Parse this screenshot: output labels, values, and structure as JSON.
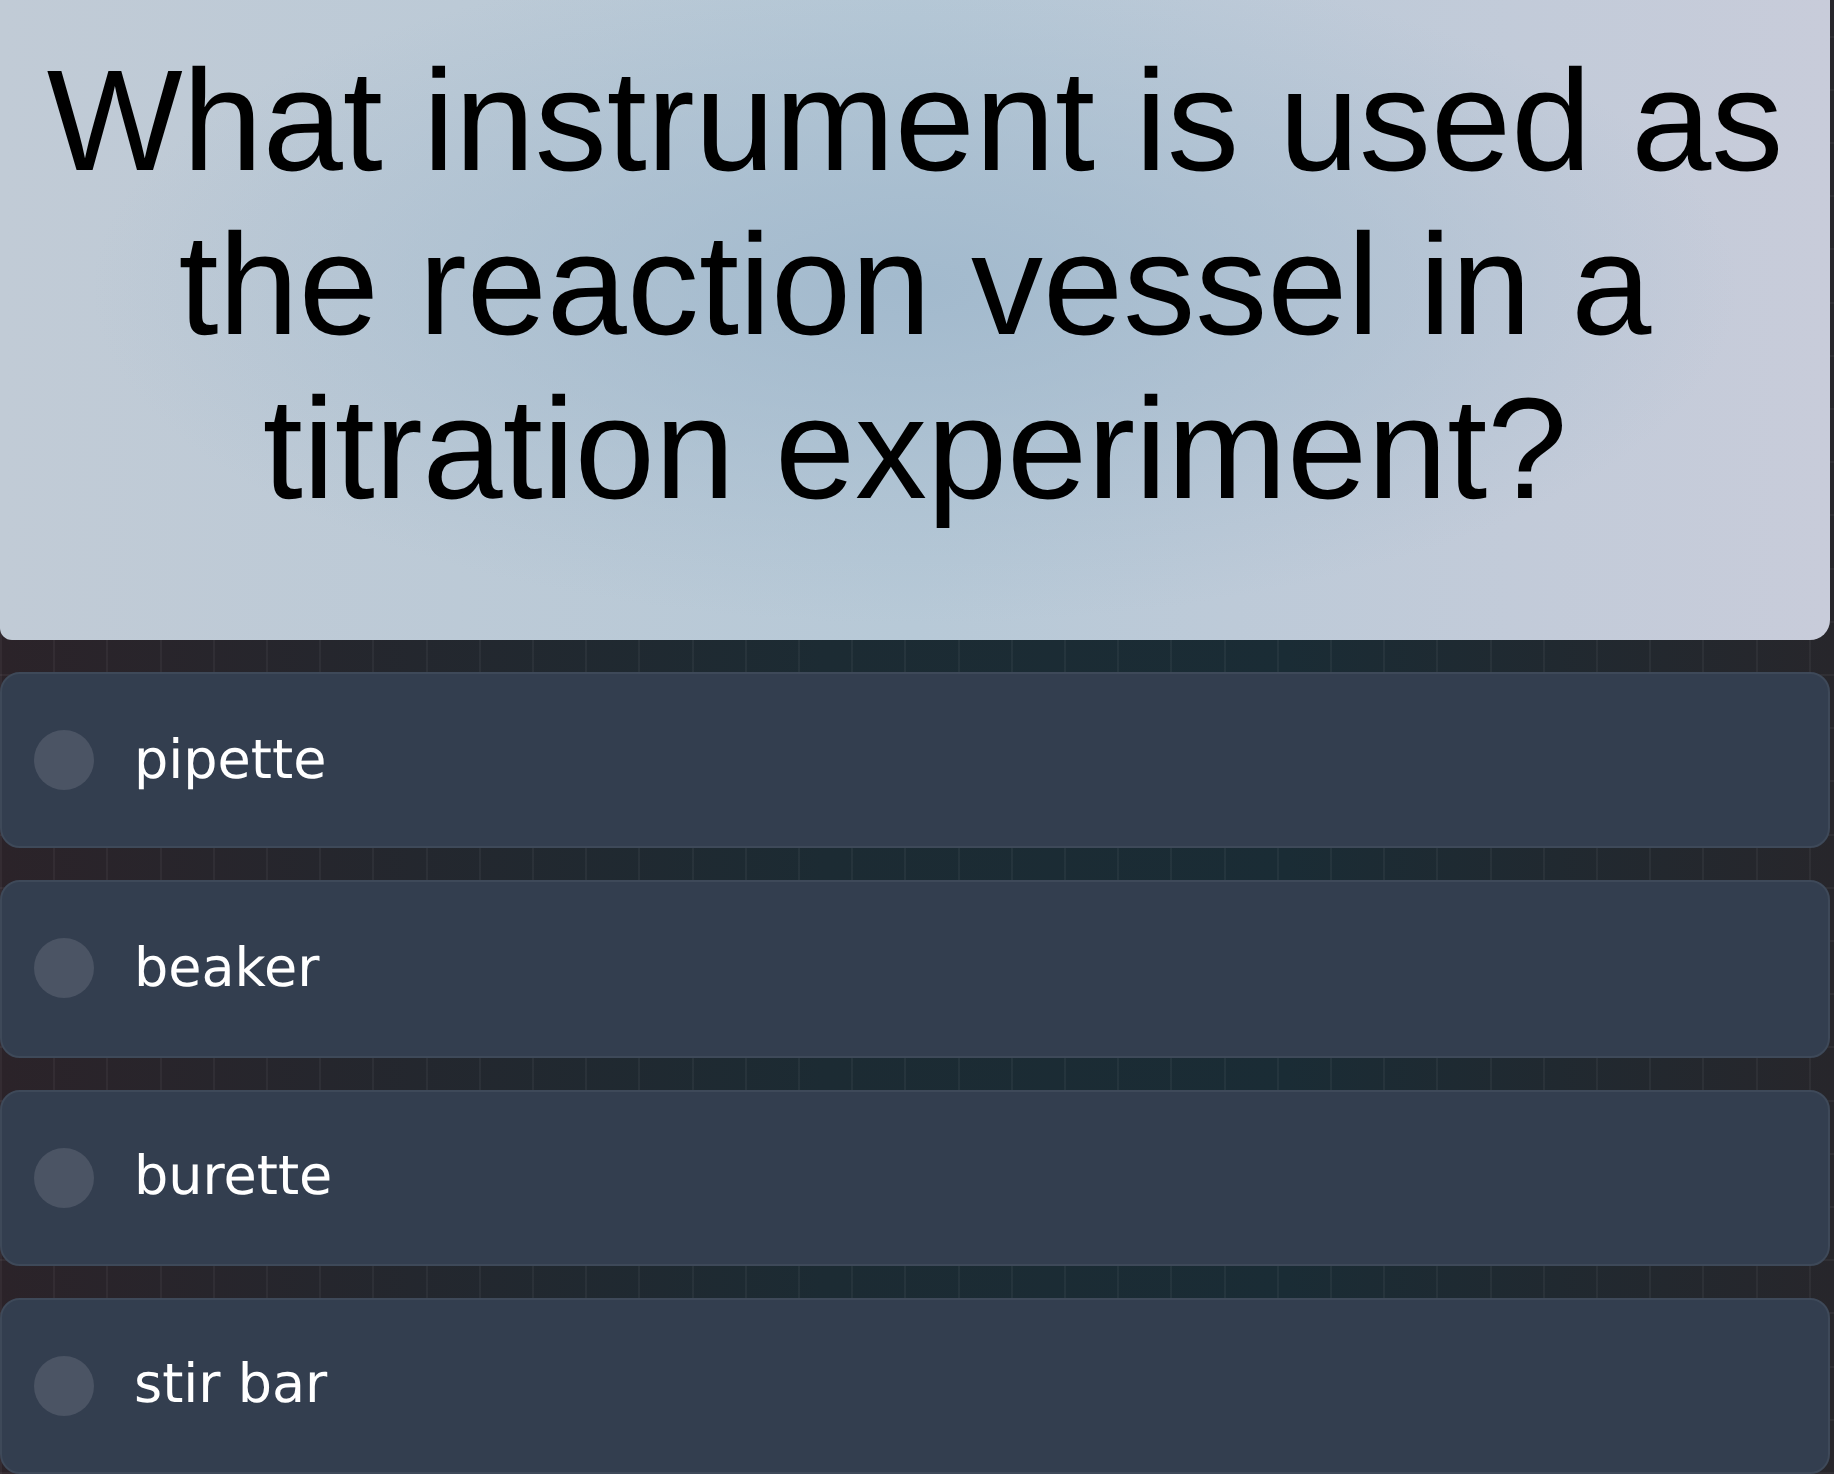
{
  "question": {
    "text": "What instrument is used as the reaction vessel in a titration experiment?"
  },
  "options": [
    {
      "label": "pipette",
      "selected": false
    },
    {
      "label": "beaker",
      "selected": false
    },
    {
      "label": "burette",
      "selected": false
    },
    {
      "label": "stir bar",
      "selected": false
    }
  ]
}
